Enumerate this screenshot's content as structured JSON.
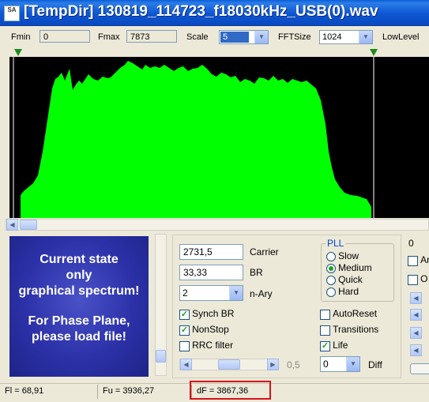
{
  "window": {
    "title": "[TempDir] 130819_114723_f18030kHz_USB(0).wav",
    "app_icon_text": "SA",
    "icon": "app-icon"
  },
  "toolbar": {
    "fmin_label": "Fmin",
    "fmin_value": "0",
    "fmax_label": "Fmax",
    "fmax_value": "7873",
    "scale_label": "Scale",
    "scale_value": "5",
    "fftsize_label": "FFTSize",
    "fftsize_value": "1024",
    "lowlevel_label": "LowLevel"
  },
  "spectrum": {
    "fill_color": "#00ff00",
    "background": "#000000",
    "marker_color": "#1b8c1b"
  },
  "info_panel": {
    "lines": [
      "Current state",
      "only",
      "graphical spectrum!",
      "",
      "For Phase Plane,",
      "please load file!"
    ]
  },
  "controls": {
    "carrier_value": "2731,5",
    "carrier_label": "Carrier",
    "br_value": "33,33",
    "br_label": "BR",
    "nary_value": "2",
    "nary_label": "n-Ary",
    "synch_br_label": "Synch BR",
    "synch_br_checked": true,
    "nonstop_label": "NonStop",
    "nonstop_checked": true,
    "rrc_filter_label": "RRC filter",
    "rrc_filter_checked": false,
    "autoreset_label": "AutoReset",
    "autoreset_checked": false,
    "transitions_label": "Transitions",
    "transitions_checked": false,
    "life_label": "Life",
    "life_checked": true,
    "slider_value_label": "0,5",
    "diff_value": "0",
    "diff_label": "Diff"
  },
  "pll": {
    "title": "PLL",
    "options": [
      "Slow",
      "Medium",
      "Quick",
      "Hard"
    ],
    "selected": "Medium"
  },
  "right_panel": {
    "value": "0",
    "cb1_label": "Ar",
    "cb2_label": "O"
  },
  "status": {
    "fl": "Fl = 68,91",
    "fu": "Fu = 3936,27",
    "df": "dF = 3867,36",
    "highlight_color": "#d9121b"
  }
}
